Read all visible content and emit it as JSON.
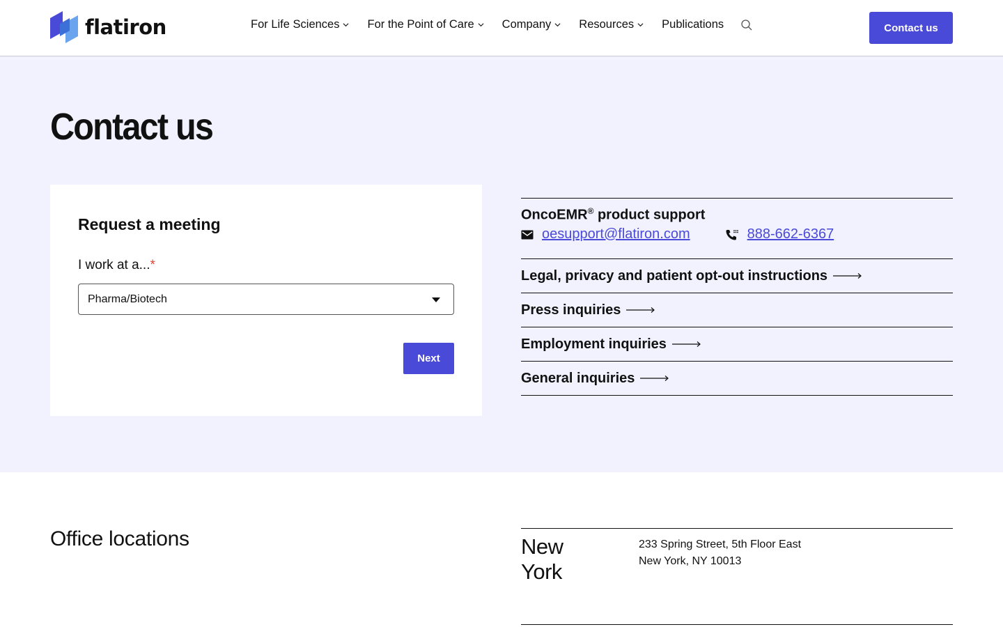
{
  "brand": {
    "name": "flatiron",
    "accent": "#4a4ad8"
  },
  "nav": {
    "items": [
      {
        "label": "For Life Sciences",
        "dropdown": true
      },
      {
        "label": "For the Point of Care",
        "dropdown": true
      },
      {
        "label": "Company",
        "dropdown": true
      },
      {
        "label": "Resources",
        "dropdown": true
      },
      {
        "label": "Publications",
        "dropdown": false
      }
    ],
    "search_icon": "search-icon",
    "cta_label": "Contact us"
  },
  "hero": {
    "title": "Contact us",
    "form": {
      "title": "Request a meeting",
      "field_label": "I work at a...",
      "required_mark": "*",
      "select_value": "Pharma/Biotech",
      "next_label": "Next"
    },
    "support": {
      "title": "OncoEMR",
      "title_suffix": " product support",
      "registered_mark": "®",
      "email": "oesupport@flatiron.com",
      "phone": "888-662-6367"
    },
    "inquiries": [
      "Legal, privacy and patient opt-out instructions",
      "Press inquiries",
      "Employment inquiries",
      "General inquiries"
    ]
  },
  "offices": {
    "title": "Office locations",
    "locations": [
      {
        "city": "New York",
        "address_line1": "233 Spring Street, 5th Floor East",
        "address_line2": "New York, NY 10013"
      }
    ]
  }
}
